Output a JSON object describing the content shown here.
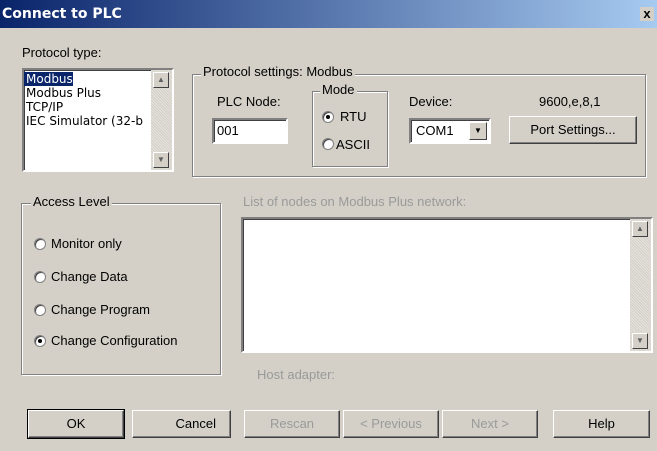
{
  "window": {
    "title": "Connect to PLC",
    "close_label": "x"
  },
  "protocol_type": {
    "label": "Protocol type:",
    "items": [
      "Modbus",
      "Modbus Plus",
      "TCP/IP",
      "IEC Simulator (32-b"
    ],
    "selected_index": 0
  },
  "protocol_settings": {
    "legend": "Protocol settings: Modbus",
    "plc_node_label": "PLC Node:",
    "plc_node_value": "001",
    "mode_legend": "Mode",
    "mode_rtu": "RTU",
    "mode_ascii": "ASCII",
    "mode_selected": "RTU",
    "device_label": "Device:",
    "device_value": "COM1",
    "port_params": "9600,e,8,1",
    "port_settings_button": "Port Settings..."
  },
  "access_level": {
    "legend": "Access Level",
    "options": [
      "Monitor only",
      "Change Data",
      "Change Program",
      "Change Configuration"
    ],
    "selected_index": 3
  },
  "modbus_plus": {
    "list_label": "List of nodes on Modbus Plus network:",
    "host_adapter_label": "Host adapter:"
  },
  "buttons": {
    "ok": "OK",
    "cancel": "Cancel",
    "rescan": "Rescan",
    "previous": "< Previous",
    "next": "Next >",
    "help": "Help"
  },
  "icons": {
    "scroll_up": "scroll-up-arrow-icon",
    "scroll_down": "scroll-down-arrow-icon",
    "dropdown": "dropdown-arrow-icon"
  }
}
